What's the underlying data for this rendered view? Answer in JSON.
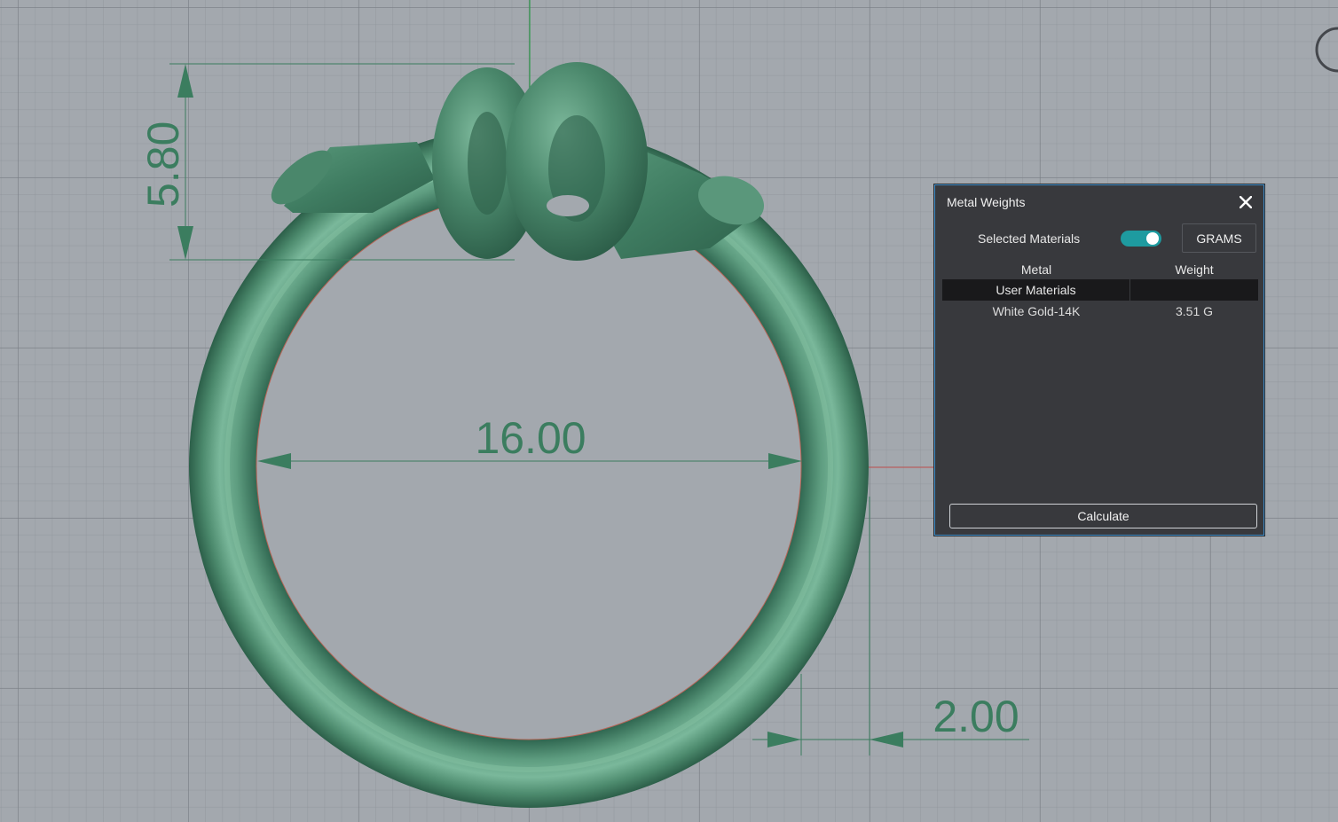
{
  "dimensions": {
    "top_height": "5.80",
    "inner_diameter": "16.00",
    "band_width": "2.00"
  },
  "panel": {
    "title": "Metal Weights",
    "close_icon": "close-icon",
    "option_label": "Selected Materials",
    "toggle_on": true,
    "unit_button": "GRAMS",
    "columns": [
      "Metal",
      "Weight"
    ],
    "group_label": "User Materials",
    "rows": [
      {
        "metal": "White Gold-14K",
        "weight": "3.51 G"
      }
    ],
    "calculate_label": "Calculate"
  },
  "colors": {
    "viewport_bg": "#a3a8ae",
    "model_green": "#4f8d70",
    "dimension_green": "#3b7d5f",
    "panel_bg": "#38393d",
    "panel_border": "#3d8cc8",
    "toggle_on": "#1e9ba0"
  }
}
